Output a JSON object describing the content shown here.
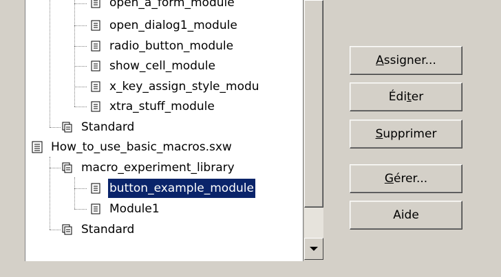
{
  "tree": {
    "items": [
      {
        "label": "open_a_form_module",
        "type": "module"
      },
      {
        "label": "open_dialog1_module",
        "type": "module"
      },
      {
        "label": "radio_button_module",
        "type": "module"
      },
      {
        "label": "show_cell_module",
        "type": "module"
      },
      {
        "label": "x_key_assign_style_modu",
        "type": "module"
      },
      {
        "label": "xtra_stuff_module",
        "type": "module"
      },
      {
        "label": "Standard",
        "type": "library"
      },
      {
        "label": "How_to_use_basic_macros.sxw",
        "type": "document"
      },
      {
        "label": "macro_experiment_library",
        "type": "library"
      },
      {
        "label": "button_example_module",
        "type": "module",
        "selected": true
      },
      {
        "label": "Module1",
        "type": "module"
      },
      {
        "label": "Standard",
        "type": "library"
      }
    ]
  },
  "buttons": {
    "assign": {
      "pre": "",
      "key": "A",
      "post": "ssigner..."
    },
    "edit": {
      "pre": "Édi",
      "key": "t",
      "post": "er"
    },
    "delete": {
      "pre": "",
      "key": "S",
      "post": "upprimer"
    },
    "manage": {
      "pre": "",
      "key": "G",
      "post": "érer..."
    },
    "help": {
      "pre": "",
      "key": "",
      "post": "Aide"
    }
  },
  "colors": {
    "selection": "#0a246a",
    "face": "#d4d0c8"
  }
}
